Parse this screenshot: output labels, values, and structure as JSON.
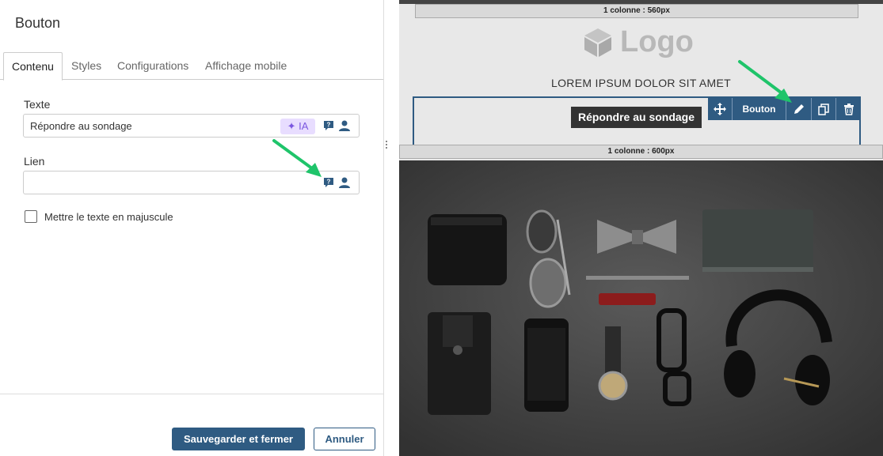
{
  "panel": {
    "title": "Bouton",
    "tabs": [
      {
        "label": "Contenu",
        "active": true
      },
      {
        "label": "Styles",
        "active": false
      },
      {
        "label": "Configurations",
        "active": false
      },
      {
        "label": "Affichage mobile",
        "active": false
      }
    ],
    "fields": {
      "texte_label": "Texte",
      "texte_value": "Répondre au sondage",
      "ia_label": "IA",
      "lien_label": "Lien",
      "lien_value": ""
    },
    "checkbox_label": "Mettre le texte en majuscule",
    "checkbox_checked": false,
    "save_label": "Sauvegarder et fermer",
    "cancel_label": "Annuler"
  },
  "canvas": {
    "top_column_label": "1 colonne : 560px",
    "logo_text": "Logo",
    "headline": "LOREM IPSUM DOLOR SIT AMET",
    "preview_button_label": "Répondre au sondage",
    "toolbar_label": "Bouton",
    "bottom_column_label": "1 colonne : 600px",
    "photo_alt": "flat-lay-accessories"
  },
  "colors": {
    "primary": "#2f5b82",
    "ia_bg": "#e8ddff",
    "ia_text": "#7b57e0",
    "arrow": "#1fc46a"
  }
}
